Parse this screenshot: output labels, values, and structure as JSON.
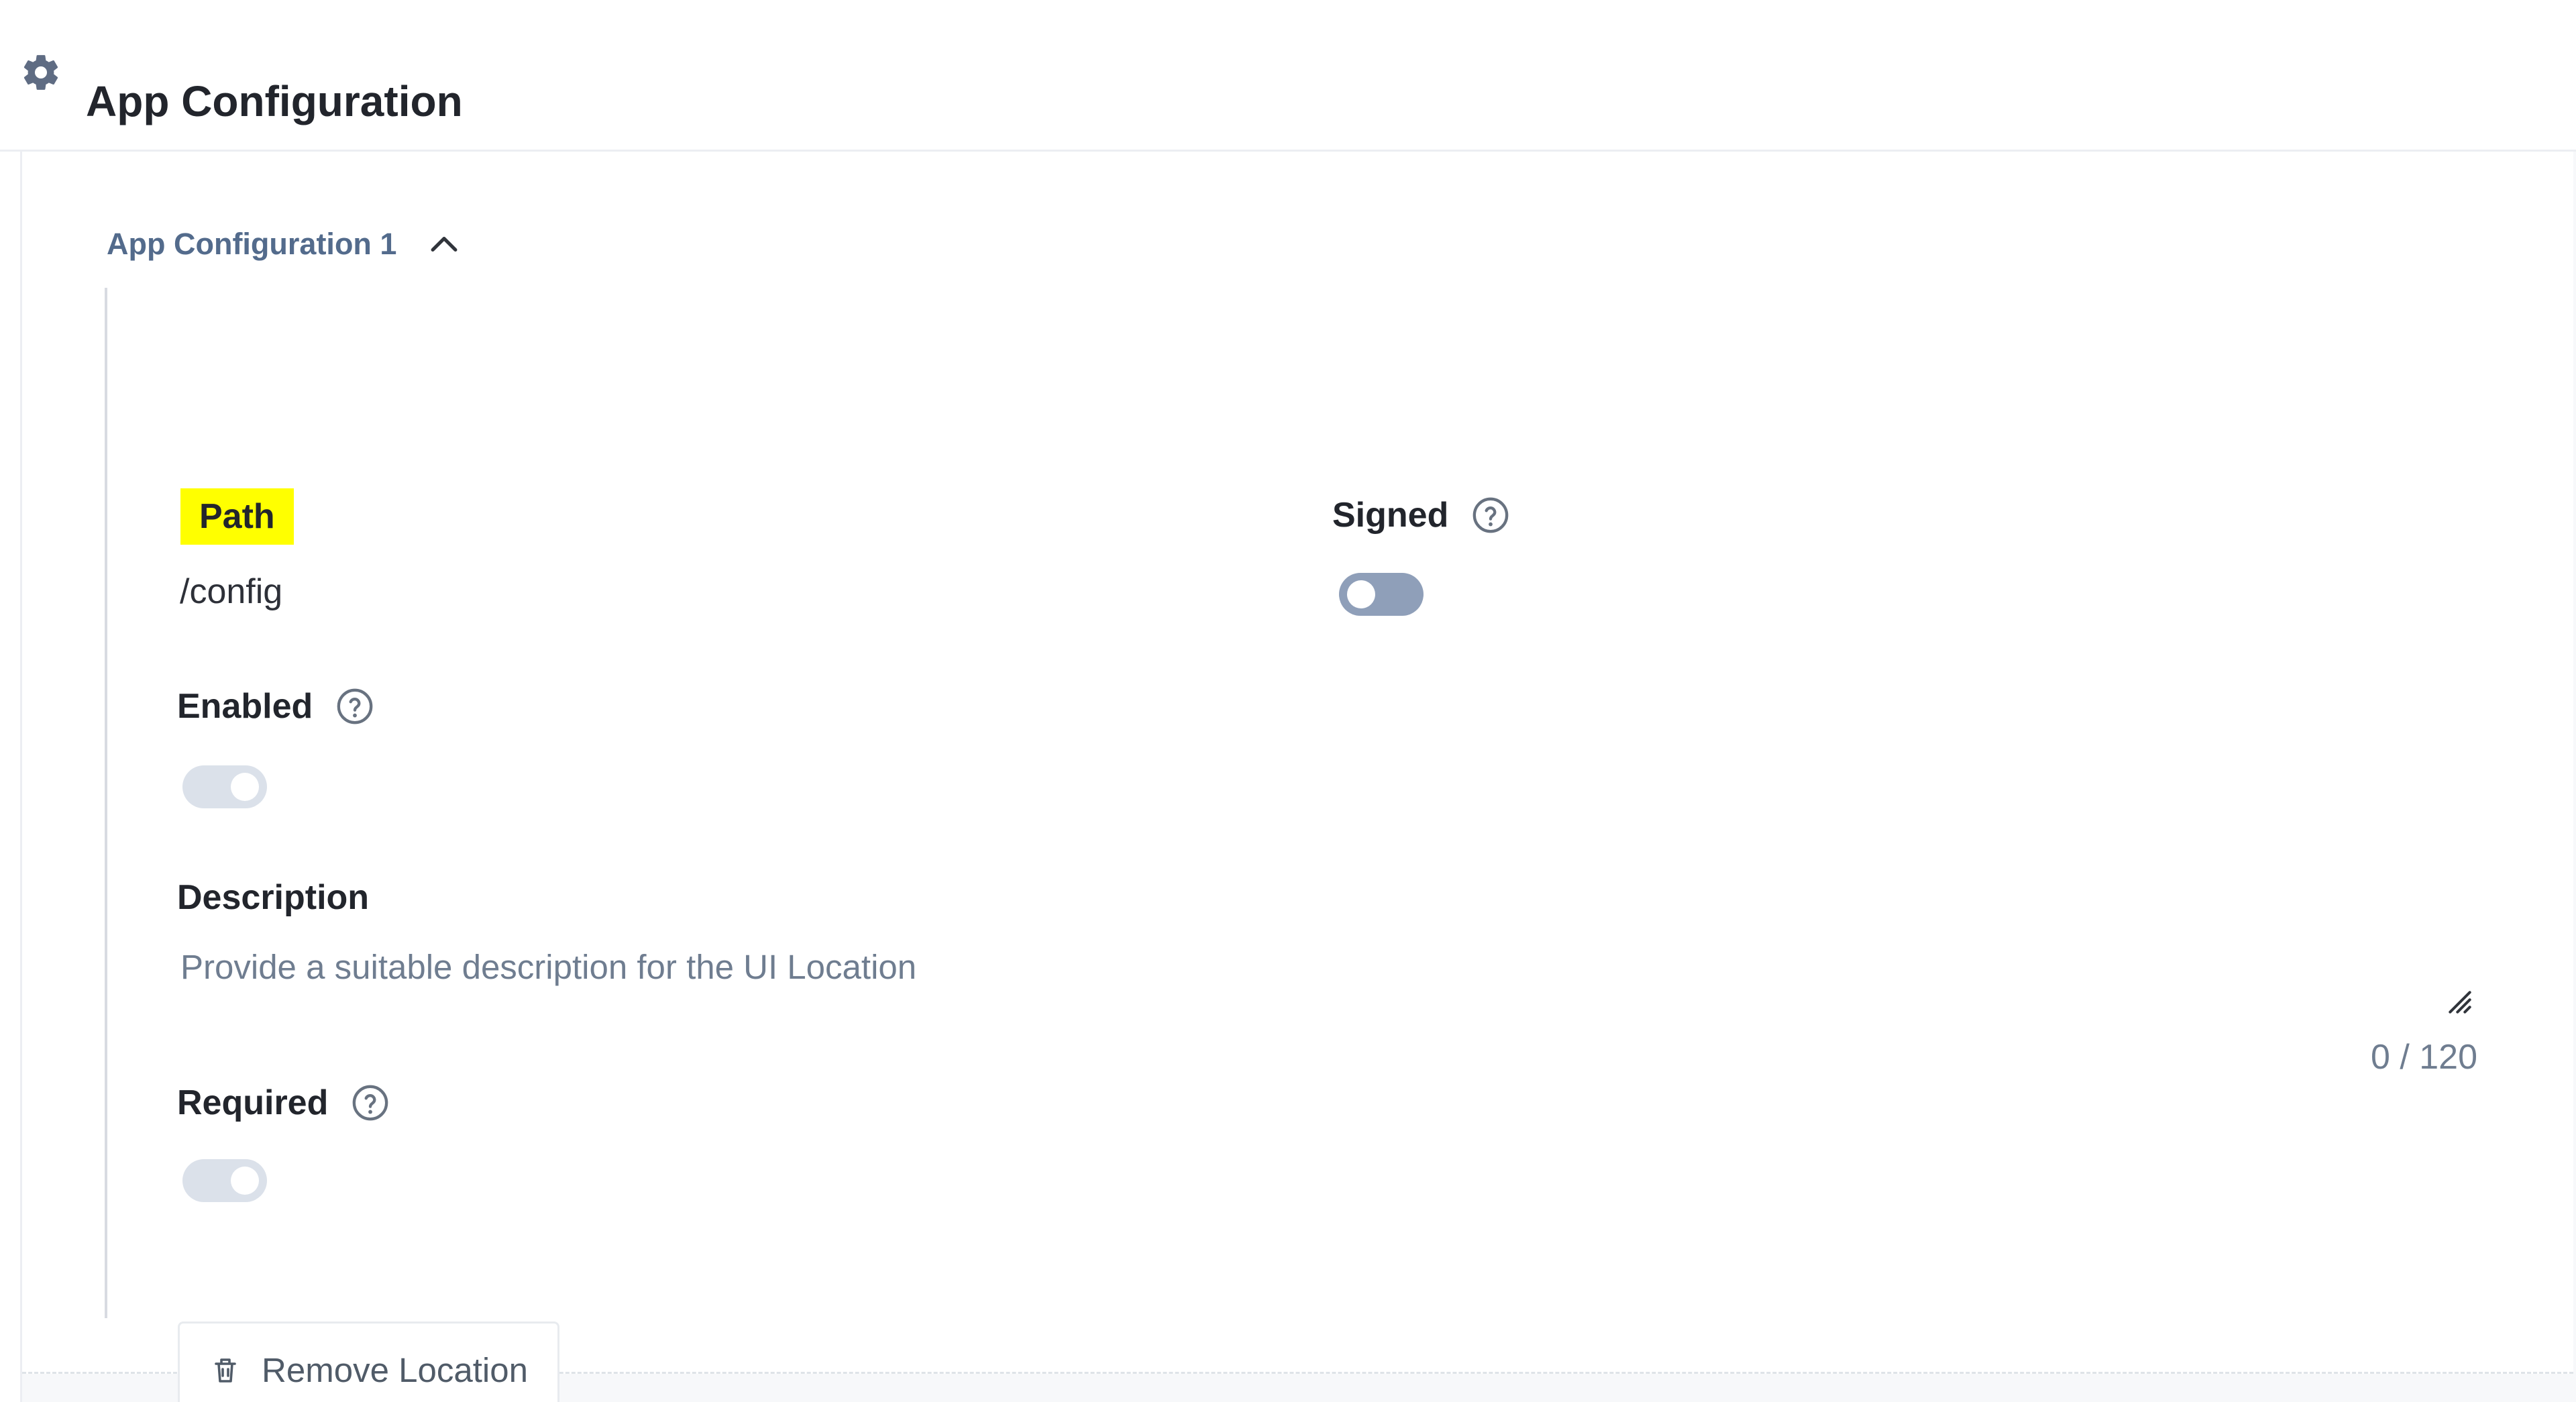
{
  "header": {
    "title": "App Configuration",
    "icon": "gear-icon"
  },
  "section": {
    "title": "App Configuration 1",
    "expanded": true,
    "toggle_icon": "chevron-up-icon"
  },
  "fields": {
    "path": {
      "label": "Path",
      "value": "/config",
      "highlight_color": "#ffff00"
    },
    "signed": {
      "label": "Signed",
      "state": "off",
      "help_icon": "help-icon"
    },
    "enabled": {
      "label": "Enabled",
      "state": "on, disabled",
      "help_icon": "help-icon"
    },
    "description": {
      "label": "Description",
      "value": "",
      "placeholder": "Provide a suitable description for the UI Location",
      "count": "0 / 120",
      "resize_icon": "resize-handle-icon"
    },
    "required": {
      "label": "Required",
      "state": "on, disabled",
      "help_icon": "help-icon"
    }
  },
  "actions": {
    "remove_location": {
      "label": "Remove Location",
      "icon": "trash-icon"
    }
  },
  "colors": {
    "label_highlight": "#ffff00",
    "section_title": "#536b8c",
    "toggle_off": "#8f9fb9",
    "toggle_disabled": "#dbe1ea",
    "placeholder": "#6f7d90"
  }
}
